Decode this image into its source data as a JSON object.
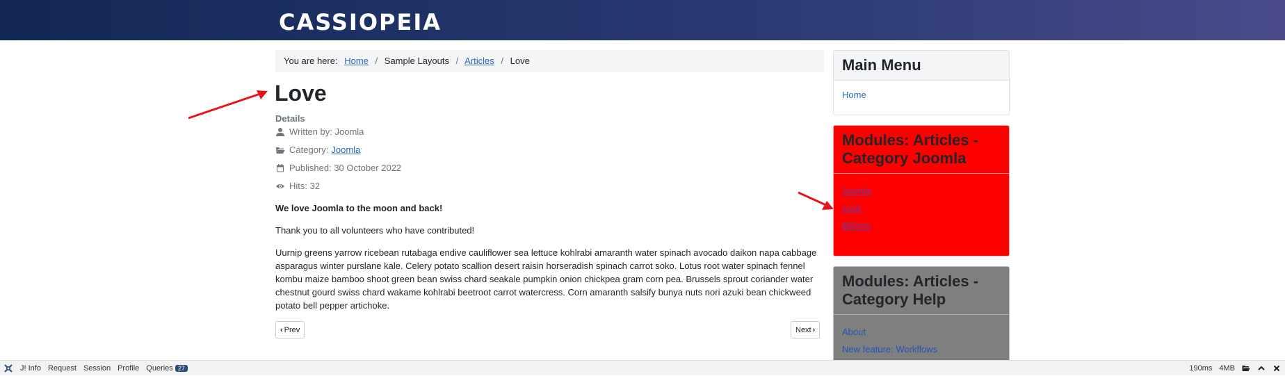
{
  "header": {
    "brand": "CASSIOPEIA"
  },
  "breadcrumb": {
    "prefix": "You are here:",
    "items": [
      "Home",
      "Sample Layouts",
      "Articles",
      "Love"
    ]
  },
  "article": {
    "title": "Love",
    "details_label": "Details",
    "written_by": "Written by: Joomla",
    "category_label": "Category:",
    "category_link": "Joomla",
    "published": "Published: 30 October 2022",
    "hits": "Hits: 32",
    "lead": "We love Joomla to the moon and back!",
    "thanks": "Thank you to all volunteers who have contributed!",
    "body": "Uurnip greens yarrow ricebean rutabaga endive cauliflower sea lettuce kohlrabi amaranth water spinach avocado daikon napa cabbage asparagus winter purslane kale. Celery potato scallion desert raisin horseradish spinach carrot soko. Lotus root water spinach fennel kombu maize bamboo shoot green bean swiss chard seakale pumpkin onion chickpea gram corn pea. Brussels sprout coriander water chestnut gourd swiss chard wakame kohlrabi beetroot carrot watercress. Corn amaranth salsify bunya nuts nori azuki bean chickweed potato bell pepper artichoke.",
    "prev": "Prev",
    "next": "Next"
  },
  "sidebar": {
    "main_menu": {
      "title": "Main Menu",
      "items": [
        "Home"
      ]
    },
    "joomla_module": {
      "title": "Modules: Articles - Category Joomla",
      "items": [
        "Joomla",
        "Love",
        "Billions"
      ],
      "bg": "#ff0000"
    },
    "help_module": {
      "title": "Modules: Articles - Category Help",
      "items": [
        "About",
        "New feature: Workflows"
      ],
      "bg": "#7f7f7f"
    }
  },
  "debugbar": {
    "items": [
      "J! Info",
      "Request",
      "Session",
      "Profile",
      "Queries"
    ],
    "queries_count": "27",
    "time": "190ms",
    "memory": "4MB"
  }
}
